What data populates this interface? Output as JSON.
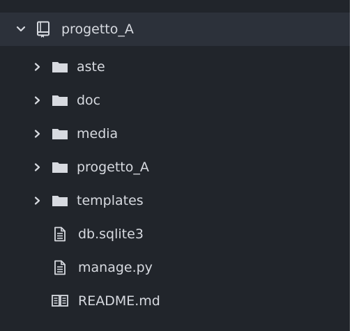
{
  "tree": {
    "root": {
      "label": "progetto_A",
      "expanded": true,
      "icon": "repo-book-icon"
    },
    "children": [
      {
        "label": "aste",
        "type": "folder",
        "icon": "folder-icon",
        "expanded": false
      },
      {
        "label": "doc",
        "type": "folder",
        "icon": "folder-icon",
        "expanded": false
      },
      {
        "label": "media",
        "type": "folder",
        "icon": "folder-icon",
        "expanded": false
      },
      {
        "label": "progetto_A",
        "type": "folder",
        "icon": "folder-icon",
        "expanded": false
      },
      {
        "label": "templates",
        "type": "folder",
        "icon": "folder-icon",
        "expanded": false
      },
      {
        "label": "db.sqlite3",
        "type": "file",
        "icon": "file-text-icon"
      },
      {
        "label": "manage.py",
        "type": "file",
        "icon": "file-text-icon"
      },
      {
        "label": "README.md",
        "type": "file",
        "icon": "book-open-icon"
      }
    ]
  },
  "colors": {
    "panel_bg": "#21252b",
    "selected_bg": "#2c313a",
    "text": "#d7dae0",
    "icon": "#d7dae0"
  }
}
